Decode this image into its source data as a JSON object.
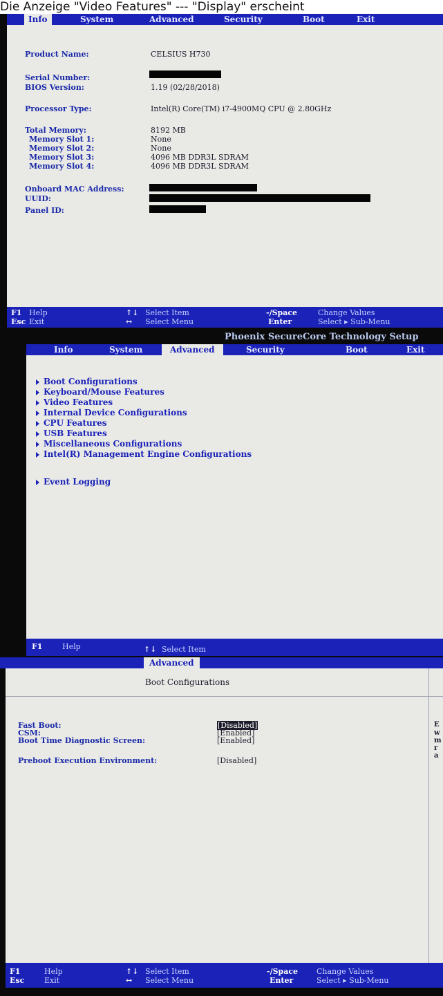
{
  "caption": "Die Anzeige \"Video Features\" --- \"Display\" erscheint",
  "setup_title": "Phoenix SecureCore Technology Setup",
  "shot1": {
    "menu": [
      "Info",
      "System",
      "Advanced",
      "Security",
      "Boot",
      "Exit"
    ],
    "active_tab": "Info",
    "fields": {
      "product_name_label": "Product Name:",
      "product_name": "CELSIUS H730",
      "serial_number_label": "Serial Number:",
      "bios_version_label": "BIOS Version:",
      "bios_version": "1.19 (02/28/2018)",
      "processor_type_label": "Processor Type:",
      "processor_type": "Intel(R) Core(TM) i7-4900MQ CPU @ 2.80GHz",
      "total_memory_label": "Total Memory:",
      "total_memory": "8192 MB",
      "memory_slot_1_label": "Memory Slot 1:",
      "memory_slot_1": "None",
      "memory_slot_2_label": "Memory Slot 2:",
      "memory_slot_2": "None",
      "memory_slot_3_label": "Memory Slot 3:",
      "memory_slot_3": "4096 MB DDR3L SDRAM",
      "memory_slot_4_label": "Memory Slot 4:",
      "memory_slot_4": "4096 MB DDR3L SDRAM",
      "mac_label": "Onboard MAC Address:",
      "uuid_label": "UUID:",
      "panel_id_label": "Panel ID:"
    }
  },
  "shot2": {
    "menu": [
      "Info",
      "System",
      "Advanced",
      "Security",
      "Boot",
      "Exit"
    ],
    "active_tab": "Advanced",
    "submenus": [
      "Boot Configurations",
      "Keyboard/Mouse Features",
      "Video Features",
      "Internal Device Configurations",
      "CPU Features",
      "USB Features",
      "Miscellaneous Configurations",
      "Intel(R) Management Engine Configurations",
      "Event Logging"
    ],
    "footer_f1": "F1",
    "footer_help": "Help",
    "footer_arrows": "↑↓",
    "footer_select_item": "Select Item"
  },
  "shot3": {
    "active_tab": "Advanced",
    "panel_title": "Boot Configurations",
    "settings": [
      {
        "label": "Fast Boot:",
        "value": "[Disabled]"
      },
      {
        "label": "CSM:",
        "value": "[Enabled]"
      },
      {
        "label": "Boot Time Diagnostic Screen:",
        "value": "[Enabled]"
      },
      {
        "label": "Preboot Execution Environment:",
        "value": "[Disabled]"
      }
    ],
    "help_fragments": [
      "E",
      "w",
      "m",
      "r",
      "a"
    ]
  },
  "footer": {
    "f1": "F1",
    "help": "Help",
    "esc": "Esc",
    "exit": "Exit",
    "arrows_ud": "↑↓",
    "select_item": "Select Item",
    "arrows_lr": "↔",
    "select_menu": "Select Menu",
    "minus_space": "-/Space",
    "change_values": "Change Values",
    "enter": "Enter",
    "select_submenu": "Select ▸ Sub-Menu"
  },
  "colors": {
    "bios_blue": "#1a22b8",
    "screen_bg": "#e9e9e6",
    "label_blue": "#1a2aa8"
  }
}
